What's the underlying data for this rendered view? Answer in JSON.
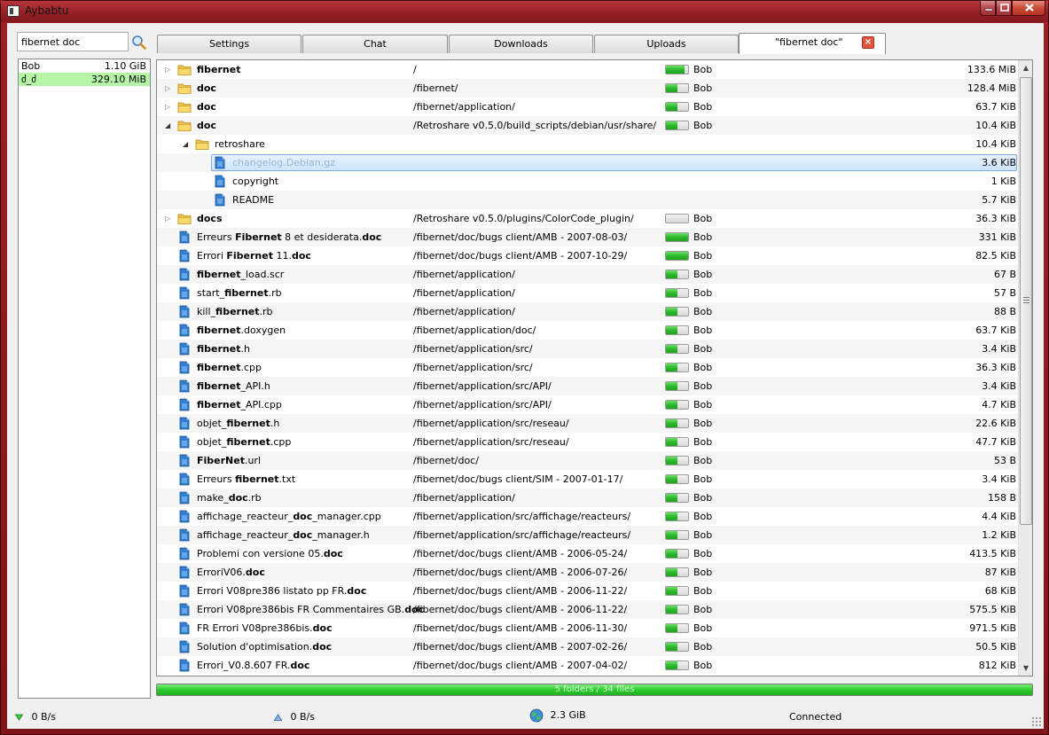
{
  "window": {
    "title": "Aybabtu"
  },
  "search": {
    "value": "fibernet doc"
  },
  "tabs": [
    {
      "label": "Settings"
    },
    {
      "label": "Chat"
    },
    {
      "label": "Downloads"
    },
    {
      "label": "Uploads"
    },
    {
      "label": "\"fibernet doc\"",
      "close_icon": "close-icon"
    }
  ],
  "peers": [
    {
      "name": "Bob",
      "size": "1.10 GiB"
    },
    {
      "name": "ძ_ძ",
      "size": "329.10 MiB"
    }
  ],
  "results": [
    {
      "kind": "folder",
      "level": 0,
      "arrow": "closed",
      "name": [
        [
          "fibernet",
          true
        ]
      ],
      "path": "/",
      "source": "Bob",
      "avail": 0.85,
      "size": "133.6 MiB"
    },
    {
      "kind": "folder",
      "level": 0,
      "arrow": "closed",
      "name": [
        [
          "doc",
          true
        ]
      ],
      "path": "/fibernet/",
      "source": "Bob",
      "avail": 0.5,
      "size": "128.4 MiB"
    },
    {
      "kind": "folder",
      "level": 0,
      "arrow": "closed",
      "name": [
        [
          "doc",
          true
        ]
      ],
      "path": "/fibernet/application/",
      "source": "Bob",
      "avail": 0.5,
      "size": "63.7 KiB"
    },
    {
      "kind": "folder",
      "level": 0,
      "arrow": "open",
      "name": [
        [
          "doc",
          true
        ]
      ],
      "path": "/Retroshare v0.5.0/build_scripts/debian/usr/share/",
      "source": "Bob",
      "avail": 0.5,
      "size": "10.4 KiB"
    },
    {
      "kind": "folder",
      "level": 1,
      "arrow": "open",
      "name": [
        [
          "retroshare",
          false
        ]
      ],
      "path": "",
      "source": "",
      "size": "10.4 KiB"
    },
    {
      "kind": "file",
      "level": 2,
      "arrow": "",
      "selected": true,
      "name": [
        [
          "changelog.Debian.gz",
          false
        ]
      ],
      "path": "",
      "source": "",
      "size": "3.6 KiB"
    },
    {
      "kind": "file",
      "level": 2,
      "arrow": "",
      "name": [
        [
          "copyright",
          false
        ]
      ],
      "path": "",
      "source": "",
      "size": "1 KiB"
    },
    {
      "kind": "file",
      "level": 2,
      "arrow": "",
      "name": [
        [
          "README",
          false
        ]
      ],
      "path": "",
      "source": "",
      "size": "5.7 KiB"
    },
    {
      "kind": "folder",
      "level": 0,
      "arrow": "closed",
      "name": [
        [
          "docs",
          true
        ]
      ],
      "path": "/Retroshare v0.5.0/plugins/ColorCode_plugin/",
      "source": "Bob",
      "avail": 0.0,
      "size": "36.3 KiB"
    },
    {
      "kind": "file",
      "level": 0,
      "arrow": "",
      "name": [
        [
          "Erreurs ",
          false
        ],
        [
          "Fibernet",
          true
        ],
        [
          " 8 et desiderata.",
          false
        ],
        [
          "doc",
          true
        ]
      ],
      "path": "/fibernet/doc/bugs client/AMB - 2007-08-03/",
      "source": "Bob",
      "avail": 1.0,
      "size": "331 KiB"
    },
    {
      "kind": "file",
      "level": 0,
      "arrow": "",
      "name": [
        [
          "Errori ",
          false
        ],
        [
          "Fibernet",
          true
        ],
        [
          " 11.",
          false
        ],
        [
          "doc",
          true
        ]
      ],
      "path": "/fibernet/doc/bugs client/AMB - 2007-10-29/",
      "source": "Bob",
      "avail": 1.0,
      "size": "82.5 KiB"
    },
    {
      "kind": "file",
      "level": 0,
      "arrow": "",
      "name": [
        [
          "fibernet",
          true
        ],
        [
          "_load.scr",
          false
        ]
      ],
      "path": "/fibernet/application/",
      "source": "Bob",
      "avail": 0.5,
      "size": "67 B"
    },
    {
      "kind": "file",
      "level": 0,
      "arrow": "",
      "name": [
        [
          "start_",
          false
        ],
        [
          "fibernet",
          true
        ],
        [
          ".rb",
          false
        ]
      ],
      "path": "/fibernet/application/",
      "source": "Bob",
      "avail": 0.5,
      "size": "57 B"
    },
    {
      "kind": "file",
      "level": 0,
      "arrow": "",
      "name": [
        [
          "kill_",
          false
        ],
        [
          "fibernet",
          true
        ],
        [
          ".rb",
          false
        ]
      ],
      "path": "/fibernet/application/",
      "source": "Bob",
      "avail": 0.5,
      "size": "88 B"
    },
    {
      "kind": "file",
      "level": 0,
      "arrow": "",
      "name": [
        [
          "fibernet",
          true
        ],
        [
          ".doxygen",
          false
        ]
      ],
      "path": "/fibernet/application/doc/",
      "source": "Bob",
      "avail": 0.5,
      "size": "63.7 KiB"
    },
    {
      "kind": "file",
      "level": 0,
      "arrow": "",
      "name": [
        [
          "fibernet",
          true
        ],
        [
          ".h",
          false
        ]
      ],
      "path": "/fibernet/application/src/",
      "source": "Bob",
      "avail": 0.5,
      "size": "3.4 KiB"
    },
    {
      "kind": "file",
      "level": 0,
      "arrow": "",
      "name": [
        [
          "fibernet",
          true
        ],
        [
          ".cpp",
          false
        ]
      ],
      "path": "/fibernet/application/src/",
      "source": "Bob",
      "avail": 0.5,
      "size": "36.3 KiB"
    },
    {
      "kind": "file",
      "level": 0,
      "arrow": "",
      "name": [
        [
          "fibernet",
          true
        ],
        [
          "_API.h",
          false
        ]
      ],
      "path": "/fibernet/application/src/API/",
      "source": "Bob",
      "avail": 0.5,
      "size": "3.4 KiB"
    },
    {
      "kind": "file",
      "level": 0,
      "arrow": "",
      "name": [
        [
          "fibernet",
          true
        ],
        [
          "_API.cpp",
          false
        ]
      ],
      "path": "/fibernet/application/src/API/",
      "source": "Bob",
      "avail": 0.5,
      "size": "4.7 KiB"
    },
    {
      "kind": "file",
      "level": 0,
      "arrow": "",
      "name": [
        [
          "objet_",
          false
        ],
        [
          "fibernet",
          true
        ],
        [
          ".h",
          false
        ]
      ],
      "path": "/fibernet/application/src/reseau/",
      "source": "Bob",
      "avail": 0.5,
      "size": "22.6 KiB"
    },
    {
      "kind": "file",
      "level": 0,
      "arrow": "",
      "name": [
        [
          "objet_",
          false
        ],
        [
          "fibernet",
          true
        ],
        [
          ".cpp",
          false
        ]
      ],
      "path": "/fibernet/application/src/reseau/",
      "source": "Bob",
      "avail": 0.5,
      "size": "47.7 KiB"
    },
    {
      "kind": "file",
      "level": 0,
      "arrow": "",
      "name": [
        [
          "FiberNet",
          true
        ],
        [
          ".url",
          false
        ]
      ],
      "path": "/fibernet/doc/",
      "source": "Bob",
      "avail": 0.5,
      "size": "53 B"
    },
    {
      "kind": "file",
      "level": 0,
      "arrow": "",
      "name": [
        [
          "Erreurs ",
          false
        ],
        [
          "fibernet",
          true
        ],
        [
          ".txt",
          false
        ]
      ],
      "path": "/fibernet/doc/bugs client/SIM - 2007-01-17/",
      "source": "Bob",
      "avail": 0.5,
      "size": "3.4 KiB"
    },
    {
      "kind": "file",
      "level": 0,
      "arrow": "",
      "name": [
        [
          "make_",
          false
        ],
        [
          "doc",
          true
        ],
        [
          ".rb",
          false
        ]
      ],
      "path": "/fibernet/application/",
      "source": "Bob",
      "avail": 0.5,
      "size": "158 B"
    },
    {
      "kind": "file",
      "level": 0,
      "arrow": "",
      "name": [
        [
          "affichage_reacteur_",
          false
        ],
        [
          "doc",
          true
        ],
        [
          "_manager.cpp",
          false
        ]
      ],
      "path": "/fibernet/application/src/affichage/reacteurs/",
      "source": "Bob",
      "avail": 0.5,
      "size": "4.4 KiB"
    },
    {
      "kind": "file",
      "level": 0,
      "arrow": "",
      "name": [
        [
          "affichage_reacteur_",
          false
        ],
        [
          "doc",
          true
        ],
        [
          "_manager.h",
          false
        ]
      ],
      "path": "/fibernet/application/src/affichage/reacteurs/",
      "source": "Bob",
      "avail": 0.5,
      "size": "1.2 KiB"
    },
    {
      "kind": "file",
      "level": 0,
      "arrow": "",
      "name": [
        [
          "Problemi con versione 05.",
          false
        ],
        [
          "doc",
          true
        ]
      ],
      "path": "/fibernet/doc/bugs client/AMB - 2006-05-24/",
      "source": "Bob",
      "avail": 0.5,
      "size": "413.5 KiB"
    },
    {
      "kind": "file",
      "level": 0,
      "arrow": "",
      "name": [
        [
          "ErroriV06.",
          false
        ],
        [
          "doc",
          true
        ]
      ],
      "path": "/fibernet/doc/bugs client/AMB - 2006-07-26/",
      "source": "Bob",
      "avail": 0.5,
      "size": "87 KiB"
    },
    {
      "kind": "file",
      "level": 0,
      "arrow": "",
      "name": [
        [
          "Errori V08pre386 listato pp FR.",
          false
        ],
        [
          "doc",
          true
        ]
      ],
      "path": "/fibernet/doc/bugs client/AMB - 2006-11-22/",
      "source": "Bob",
      "avail": 0.5,
      "size": "68 KiB"
    },
    {
      "kind": "file",
      "level": 0,
      "arrow": "",
      "name": [
        [
          "Errori V08pre386bis FR Commentaires GB.",
          false
        ],
        [
          "doc",
          true
        ]
      ],
      "path": "/fibernet/doc/bugs client/AMB - 2006-11-22/",
      "source": "Bob",
      "avail": 0.5,
      "size": "575.5 KiB"
    },
    {
      "kind": "file",
      "level": 0,
      "arrow": "",
      "name": [
        [
          "FR Errori V08pre386bis.",
          false
        ],
        [
          "doc",
          true
        ]
      ],
      "path": "/fibernet/doc/bugs client/AMB - 2006-11-30/",
      "source": "Bob",
      "avail": 0.5,
      "size": "971.5 KiB"
    },
    {
      "kind": "file",
      "level": 0,
      "arrow": "",
      "name": [
        [
          "Solution d'optimisation.",
          false
        ],
        [
          "doc",
          true
        ]
      ],
      "path": "/fibernet/doc/bugs client/AMB - 2007-02-26/",
      "source": "Bob",
      "avail": 0.5,
      "size": "50.5 KiB"
    },
    {
      "kind": "file",
      "level": 0,
      "arrow": "",
      "name": [
        [
          "Errori_V0.8.607 FR.",
          false
        ],
        [
          "doc",
          true
        ]
      ],
      "path": "/fibernet/doc/bugs client/AMB - 2007-04-02/",
      "source": "Bob",
      "avail": 0.5,
      "size": "812 KiB"
    }
  ],
  "summary": {
    "text": "5 folders / 34 files",
    "progress": 1.0
  },
  "status": {
    "download_rate": "0 B/s",
    "upload_rate": "0 B/s",
    "shared_size": "2.3 GiB",
    "connection": "Connected"
  },
  "icons": {
    "folder": "folder-icon",
    "file": "document-icon",
    "search": "magnifier-icon",
    "down": "download-arrow-icon",
    "up": "upload-arrow-icon",
    "globe": "globe-icon"
  },
  "colors": {
    "accent_green": "#2bb82b",
    "selected_peer": "#b6f5a6",
    "window_frame": "#9b2027",
    "close_tab": "#e0533f"
  }
}
